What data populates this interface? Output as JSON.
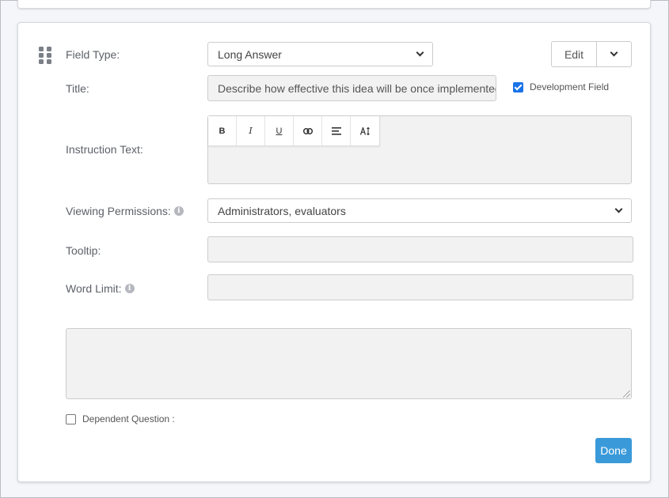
{
  "form": {
    "field_type": {
      "label": "Field Type:",
      "value": "Long Answer"
    },
    "edit_label": "Edit",
    "title": {
      "label": "Title:",
      "value": "Describe how effective this idea will be once implemented."
    },
    "development_field_label": "Development Field",
    "development_field_checked": true,
    "instruction_text": {
      "label": "Instruction Text:",
      "toolbar": [
        "B",
        "I",
        "U",
        "link-icon",
        "align-icon",
        "text-size-icon"
      ]
    },
    "viewing_permissions": {
      "label": "Viewing Permissions:",
      "value": "Administrators, evaluators"
    },
    "tooltip": {
      "label": "Tooltip:",
      "value": ""
    },
    "word_limit": {
      "label": "Word Limit:",
      "value": ""
    },
    "dependent_question_label": "Dependent Question :",
    "dependent_question_checked": false,
    "done_label": "Done"
  },
  "colors": {
    "primary_button": "#3a9ad9",
    "checkbox_checked": "#1a73e8"
  }
}
